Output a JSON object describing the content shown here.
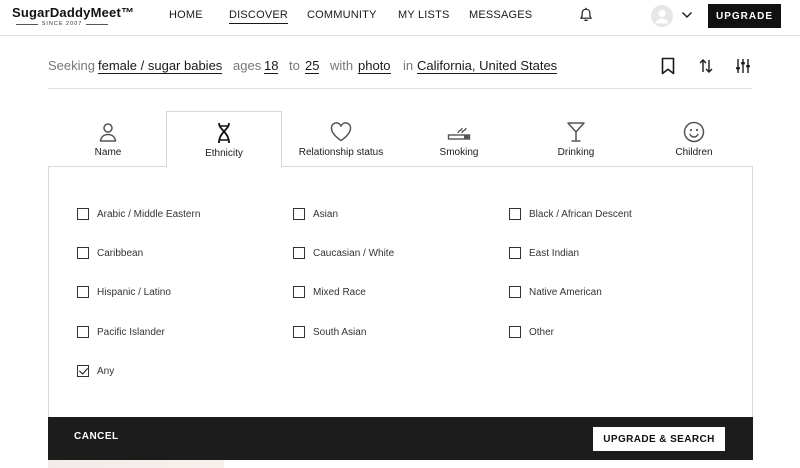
{
  "brand": {
    "name": "SugarDaddyMeet™",
    "tagline": "SINCE 2007"
  },
  "nav": {
    "items": [
      {
        "label": "HOME",
        "active": false
      },
      {
        "label": "DISCOVER",
        "active": true
      },
      {
        "label": "COMMUNITY",
        "active": false
      },
      {
        "label": "MY LISTS",
        "active": false
      },
      {
        "label": "MESSAGES",
        "active": false
      }
    ],
    "upgrade_label": "UPGRADE"
  },
  "search_summary": {
    "seeking_label": "Seeking",
    "seeking_value": "female / sugar babies",
    "ages_label": "ages",
    "age_min": "18",
    "to_label": "to",
    "age_max": "25",
    "with_label": "with",
    "with_value": "photo",
    "in_label": "in",
    "location": "California, United States"
  },
  "filter_tabs": [
    {
      "label": "Name",
      "icon": "person-icon"
    },
    {
      "label": "Ethnicity",
      "icon": "dna-icon",
      "active": true
    },
    {
      "label": "Relationship status",
      "icon": "heart-icon"
    },
    {
      "label": "Smoking",
      "icon": "cigarette-icon"
    },
    {
      "label": "Drinking",
      "icon": "cocktail-icon"
    },
    {
      "label": "Children",
      "icon": "smiley-icon"
    }
  ],
  "ethnicity_options": [
    {
      "label": "Arabic / Middle Eastern",
      "checked": false
    },
    {
      "label": "Asian",
      "checked": false
    },
    {
      "label": "Black / African Descent",
      "checked": false
    },
    {
      "label": "Caribbean",
      "checked": false
    },
    {
      "label": "Caucasian / White",
      "checked": false
    },
    {
      "label": "East Indian",
      "checked": false
    },
    {
      "label": "Hispanic / Latino",
      "checked": false
    },
    {
      "label": "Mixed Race",
      "checked": false
    },
    {
      "label": "Native American",
      "checked": false
    },
    {
      "label": "Pacific Islander",
      "checked": false
    },
    {
      "label": "South Asian",
      "checked": false
    },
    {
      "label": "Other",
      "checked": false
    },
    {
      "label": "Any",
      "checked": true
    }
  ],
  "actions": {
    "cancel_label": "CANCEL",
    "submit_label": "UPGRADE & SEARCH"
  }
}
